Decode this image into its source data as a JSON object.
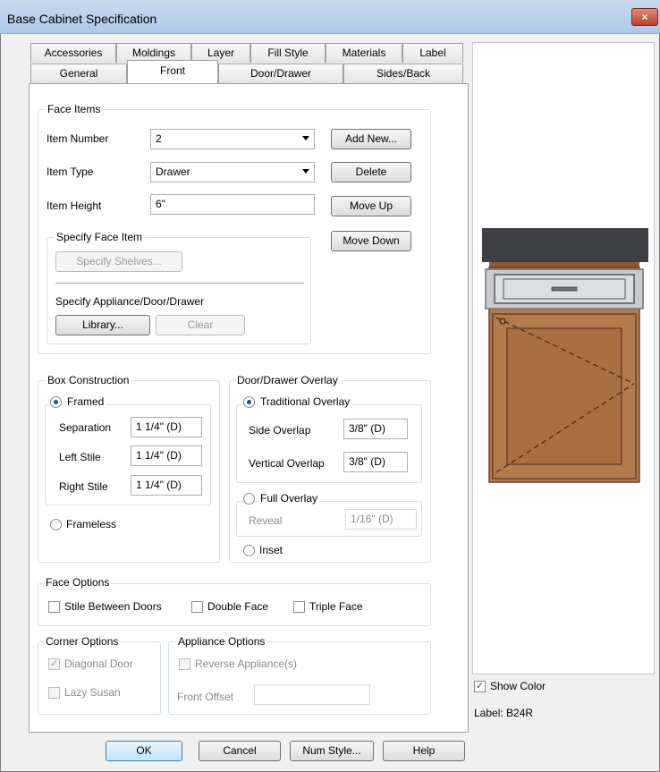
{
  "window": {
    "title": "Base Cabinet Specification",
    "close_glyph": "×"
  },
  "tabs_row1": [
    "Accessories",
    "Moldings",
    "Layer",
    "Fill Style",
    "Materials",
    "Label"
  ],
  "tabs_row2": [
    "General",
    "Front",
    "Door/Drawer",
    "Sides/Back"
  ],
  "active_tab": "Front",
  "face_items": {
    "legend": "Face Items",
    "item_number_label": "Item Number",
    "item_number_value": "2",
    "item_type_label": "Item Type",
    "item_type_value": "Drawer",
    "item_height_label": "Item Height",
    "item_height_value": "6\"",
    "add_new": "Add New...",
    "delete": "Delete",
    "move_up": "Move Up",
    "move_down": "Move Down",
    "specify": {
      "legend": "Specify Face Item",
      "specify_shelves": "Specify Shelves...",
      "appliance_label": "Specify Appliance/Door/Drawer",
      "library": "Library...",
      "clear": "Clear"
    }
  },
  "box_construction": {
    "legend": "Box Construction",
    "framed": "Framed",
    "separation_label": "Separation",
    "separation_value": "1 1/4\" (D)",
    "left_stile_label": "Left Stile",
    "left_stile_value": "1 1/4\" (D)",
    "right_stile_label": "Right Stile",
    "right_stile_value": "1 1/4\" (D)",
    "frameless": "Frameless"
  },
  "overlay": {
    "legend": "Door/Drawer Overlay",
    "traditional": "Traditional Overlay",
    "side_overlap_label": "Side Overlap",
    "side_overlap_value": "3/8\" (D)",
    "vertical_overlap_label": "Vertical Overlap",
    "vertical_overlap_value": "3/8\" (D)",
    "full": "Full Overlay",
    "reveal_label": "Reveal",
    "reveal_value": "1/16\" (D)",
    "inset": "Inset"
  },
  "face_options": {
    "legend": "Face Options",
    "stile_between": "Stile Between Doors",
    "double_face": "Double Face",
    "triple_face": "Triple Face"
  },
  "corner_options": {
    "legend": "Corner Options",
    "diagonal_door": "Diagonal Door",
    "lazy_susan": "Lazy Susan"
  },
  "appliance_options": {
    "legend": "Appliance Options",
    "reverse": "Reverse Appliance(s)",
    "front_offset_label": "Front Offset",
    "front_offset_value": ""
  },
  "preview": {
    "show_color": "Show Color",
    "label": "Label:  B24R",
    "countertop_color": "#3d3f42",
    "wood_color": "#b37a4c",
    "appliance_color": "#c9cbcf"
  },
  "footer": {
    "ok": "OK",
    "cancel": "Cancel",
    "num_style": "Num Style...",
    "help": "Help"
  },
  "check_glyph": "✓"
}
